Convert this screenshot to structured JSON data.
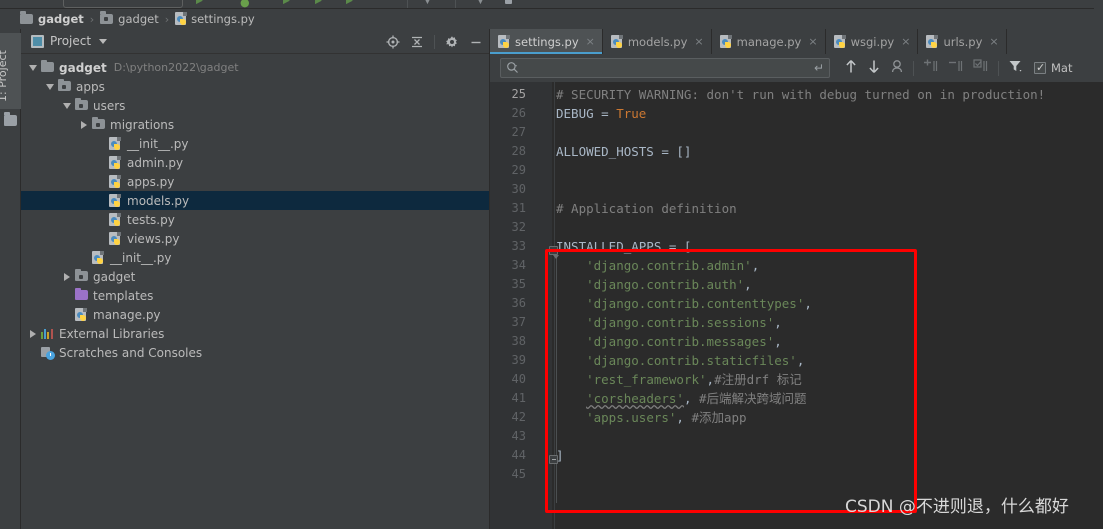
{
  "window": {
    "theme_bg": "#3c3f41",
    "editor_bg": "#2b2b2b",
    "accent": "#4a9ece",
    "annotation_color": "#fe0000"
  },
  "breadcrumb": {
    "items": [
      {
        "label": "gadget",
        "icon": "folder-icon",
        "bold": true
      },
      {
        "label": "gadget",
        "icon": "module-folder-icon",
        "bold": false
      },
      {
        "label": "settings.py",
        "icon": "python-file-icon",
        "bold": false
      }
    ],
    "separator": "›"
  },
  "left_tool_window": {
    "tab_label": "1: Project",
    "folder_icon": "folder-icon"
  },
  "project_panel": {
    "title": "Project",
    "dropdown_icon": "chevron-down-icon",
    "actions": [
      {
        "name": "locate-icon",
        "tooltip": "Select Opened File"
      },
      {
        "name": "collapse-all-icon",
        "tooltip": "Collapse All"
      },
      {
        "name": "gear-icon",
        "tooltip": "Settings"
      },
      {
        "name": "minimize-icon",
        "tooltip": "Hide"
      }
    ],
    "tree": [
      {
        "label": "gadget",
        "path": "D:\\python2022\\gadget",
        "icon": "folder-icon",
        "twisty": "down",
        "indent": 0,
        "bold": true,
        "selected": false
      },
      {
        "label": "apps",
        "path": "",
        "icon": "module-folder-icon",
        "twisty": "down",
        "indent": 1,
        "bold": false,
        "selected": false
      },
      {
        "label": "users",
        "path": "",
        "icon": "module-folder-icon",
        "twisty": "down",
        "indent": 2,
        "bold": false,
        "selected": false
      },
      {
        "label": "migrations",
        "path": "",
        "icon": "module-folder-icon",
        "twisty": "right",
        "indent": 3,
        "bold": false,
        "selected": false
      },
      {
        "label": "__init__.py",
        "path": "",
        "icon": "python-file-icon",
        "twisty": "none",
        "indent": 4,
        "bold": false,
        "selected": false
      },
      {
        "label": "admin.py",
        "path": "",
        "icon": "python-file-icon",
        "twisty": "none",
        "indent": 4,
        "bold": false,
        "selected": false
      },
      {
        "label": "apps.py",
        "path": "",
        "icon": "python-file-icon",
        "twisty": "none",
        "indent": 4,
        "bold": false,
        "selected": false
      },
      {
        "label": "models.py",
        "path": "",
        "icon": "python-file-icon",
        "twisty": "none",
        "indent": 4,
        "bold": false,
        "selected": true
      },
      {
        "label": "tests.py",
        "path": "",
        "icon": "python-file-icon",
        "twisty": "none",
        "indent": 4,
        "bold": false,
        "selected": false
      },
      {
        "label": "views.py",
        "path": "",
        "icon": "python-file-icon",
        "twisty": "none",
        "indent": 4,
        "bold": false,
        "selected": false
      },
      {
        "label": "__init__.py",
        "path": "",
        "icon": "python-file-icon",
        "twisty": "none",
        "indent": 3,
        "bold": false,
        "selected": false
      },
      {
        "label": "gadget",
        "path": "",
        "icon": "module-folder-icon",
        "twisty": "right",
        "indent": 2,
        "bold": false,
        "selected": false
      },
      {
        "label": "templates",
        "path": "",
        "icon": "templates-folder-icon",
        "twisty": "none",
        "indent": 2,
        "bold": false,
        "selected": false
      },
      {
        "label": "manage.py",
        "path": "",
        "icon": "python-file-icon",
        "twisty": "none",
        "indent": 2,
        "bold": false,
        "selected": false
      },
      {
        "label": "External Libraries",
        "path": "",
        "icon": "libraries-icon",
        "twisty": "right",
        "indent": 0,
        "bold": false,
        "selected": false
      },
      {
        "label": "Scratches and Consoles",
        "path": "",
        "icon": "scratches-icon",
        "twisty": "none",
        "indent": 0,
        "bold": false,
        "selected": false
      }
    ]
  },
  "editor": {
    "tabs": [
      {
        "label": "settings.py",
        "icon": "python-file-icon",
        "active": true,
        "close_icon": "×"
      },
      {
        "label": "models.py",
        "icon": "python-file-icon",
        "active": false,
        "close_icon": "×"
      },
      {
        "label": "manage.py",
        "icon": "python-file-icon",
        "active": false,
        "close_icon": "×"
      },
      {
        "label": "wsgi.py",
        "icon": "python-file-icon",
        "active": false,
        "close_icon": "×"
      },
      {
        "label": "urls.py",
        "icon": "python-file-icon",
        "active": false,
        "close_icon": "×"
      }
    ],
    "find_bar": {
      "search_value": "",
      "search_placeholder": "",
      "search_icon": "search-icon",
      "history_icon": "chevron-down-icon",
      "return_icon": "↵",
      "buttons": [
        {
          "name": "find-previous-icon",
          "glyph": "↑"
        },
        {
          "name": "find-next-icon",
          "glyph": "↓"
        },
        {
          "name": "select-all-occurrences-icon",
          "glyph": "⬭"
        },
        {
          "name": "add-selection-icon",
          "glyph": "+"
        },
        {
          "name": "remove-selection-icon",
          "glyph": "−"
        },
        {
          "name": "select-all-icon",
          "glyph": "☑"
        },
        {
          "name": "filter-icon",
          "glyph": "▼"
        }
      ],
      "match_case_label": "Mat",
      "match_case_checked": true
    },
    "lines": [
      {
        "num": 25,
        "tokens": [
          {
            "t": "# SECURITY WARNING: don't run with debug turned on in production!",
            "c": "cmt"
          }
        ]
      },
      {
        "num": 26,
        "tokens": [
          {
            "t": "DEBUG = ",
            "c": "def"
          },
          {
            "t": "True",
            "c": "kw"
          }
        ]
      },
      {
        "num": 27,
        "tokens": []
      },
      {
        "num": 28,
        "tokens": [
          {
            "t": "ALLOWED_HOSTS = []",
            "c": "def"
          }
        ]
      },
      {
        "num": 29,
        "tokens": []
      },
      {
        "num": 30,
        "tokens": []
      },
      {
        "num": 31,
        "tokens": [
          {
            "t": "# Application definition",
            "c": "cmt"
          }
        ]
      },
      {
        "num": 32,
        "tokens": []
      },
      {
        "num": 33,
        "tokens": [
          {
            "t": "INSTALLED_APPS = [",
            "c": "def"
          }
        ]
      },
      {
        "num": 34,
        "tokens": [
          {
            "t": "    ",
            "c": "def"
          },
          {
            "t": "'django.contrib.admin'",
            "c": "str"
          },
          {
            "t": ",",
            "c": "def"
          }
        ]
      },
      {
        "num": 35,
        "tokens": [
          {
            "t": "    ",
            "c": "def"
          },
          {
            "t": "'django.contrib.auth'",
            "c": "str"
          },
          {
            "t": ",",
            "c": "def"
          }
        ]
      },
      {
        "num": 36,
        "tokens": [
          {
            "t": "    ",
            "c": "def"
          },
          {
            "t": "'django.contrib.contenttypes'",
            "c": "str"
          },
          {
            "t": ",",
            "c": "def"
          }
        ]
      },
      {
        "num": 37,
        "tokens": [
          {
            "t": "    ",
            "c": "def"
          },
          {
            "t": "'django.contrib.sessions'",
            "c": "str"
          },
          {
            "t": ",",
            "c": "def"
          }
        ]
      },
      {
        "num": 38,
        "tokens": [
          {
            "t": "    ",
            "c": "def"
          },
          {
            "t": "'django.contrib.messages'",
            "c": "str"
          },
          {
            "t": ",",
            "c": "def"
          }
        ]
      },
      {
        "num": 39,
        "tokens": [
          {
            "t": "    ",
            "c": "def"
          },
          {
            "t": "'django.contrib.staticfiles'",
            "c": "str"
          },
          {
            "t": ",",
            "c": "def"
          }
        ]
      },
      {
        "num": 40,
        "tokens": [
          {
            "t": "    ",
            "c": "def"
          },
          {
            "t": "'rest_framework'",
            "c": "str"
          },
          {
            "t": ",",
            "c": "def"
          },
          {
            "t": "#注册drf 标记",
            "c": "cmt"
          }
        ]
      },
      {
        "num": 41,
        "tokens": [
          {
            "t": "    ",
            "c": "def"
          },
          {
            "t": "'corsheaders'",
            "c": "str squig"
          },
          {
            "t": ", ",
            "c": "def"
          },
          {
            "t": "#后端解决跨域问题",
            "c": "cmt"
          }
        ]
      },
      {
        "num": 42,
        "tokens": [
          {
            "t": "    ",
            "c": "def"
          },
          {
            "t": "'apps.users'",
            "c": "str"
          },
          {
            "t": ", ",
            "c": "def"
          },
          {
            "t": "#添加app",
            "c": "cmt"
          }
        ]
      },
      {
        "num": 43,
        "tokens": []
      },
      {
        "num": 44,
        "tokens": [
          {
            "t": "]",
            "c": "def"
          }
        ]
      },
      {
        "num": 45,
        "tokens": []
      }
    ]
  },
  "annotation": {
    "watermark": "CSDN @不进则退，什么都好",
    "redbox_label": "installed-apps-highlight"
  }
}
